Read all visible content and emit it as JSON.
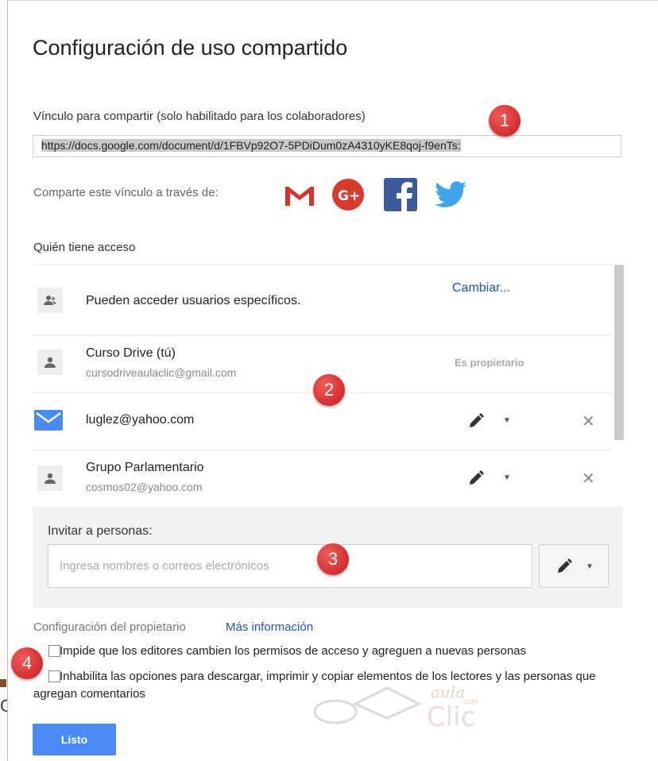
{
  "dialog": {
    "title": "Configuración de uso compartido",
    "link_label": "Vínculo para compartir (solo habilitado para los colaboradores)",
    "link_value": "https://docs.google.com/document/d/1FBVp92O7-5PDiDum0zA4310yKE8qoj-f9enTs:",
    "share_via_label": "Comparte este vínculo a través de:",
    "share_icons": [
      "gmail-icon",
      "google-plus-icon",
      "facebook-icon",
      "twitter-icon"
    ],
    "access_label": "Quién tiene acceso",
    "access_rows": [
      {
        "text": "Pueden acceder usuarios específicos.",
        "action": "Cambiar..."
      },
      {
        "name": "Curso Drive (tú)",
        "email": "cursodriveaulaclic@gmail.com",
        "role": "Es propietario"
      },
      {
        "email": "luglez@yahoo.com"
      },
      {
        "name": "Grupo Parlamentario",
        "email": "cosmos02@yahoo.com"
      }
    ],
    "invite": {
      "label": "Invitar a personas:",
      "placeholder": "Ingresa nombres o correos electrónicos"
    },
    "owner_settings_label": "Configuración del propietario",
    "more_info_link": "Más información",
    "options": [
      {
        "label": "Impide que los editores cambien los permisos de acceso y agreguen a nuevas personas",
        "checked": false
      },
      {
        "label": "Inhabilita las opciones para descargar, imprimir y copiar elementos de los lectores y las personas que agregan comentarios",
        "checked": false
      }
    ],
    "done_button": "Listo"
  },
  "badges": [
    "1",
    "2",
    "3",
    "4"
  ],
  "watermark": {
    "top": "aula",
    "sub": ".com",
    "bottom": "Clic"
  },
  "cut_letter": "C",
  "colors": {
    "accent": "#4a8af4",
    "link": "#1a55c8",
    "badge": "#d92b2b"
  }
}
